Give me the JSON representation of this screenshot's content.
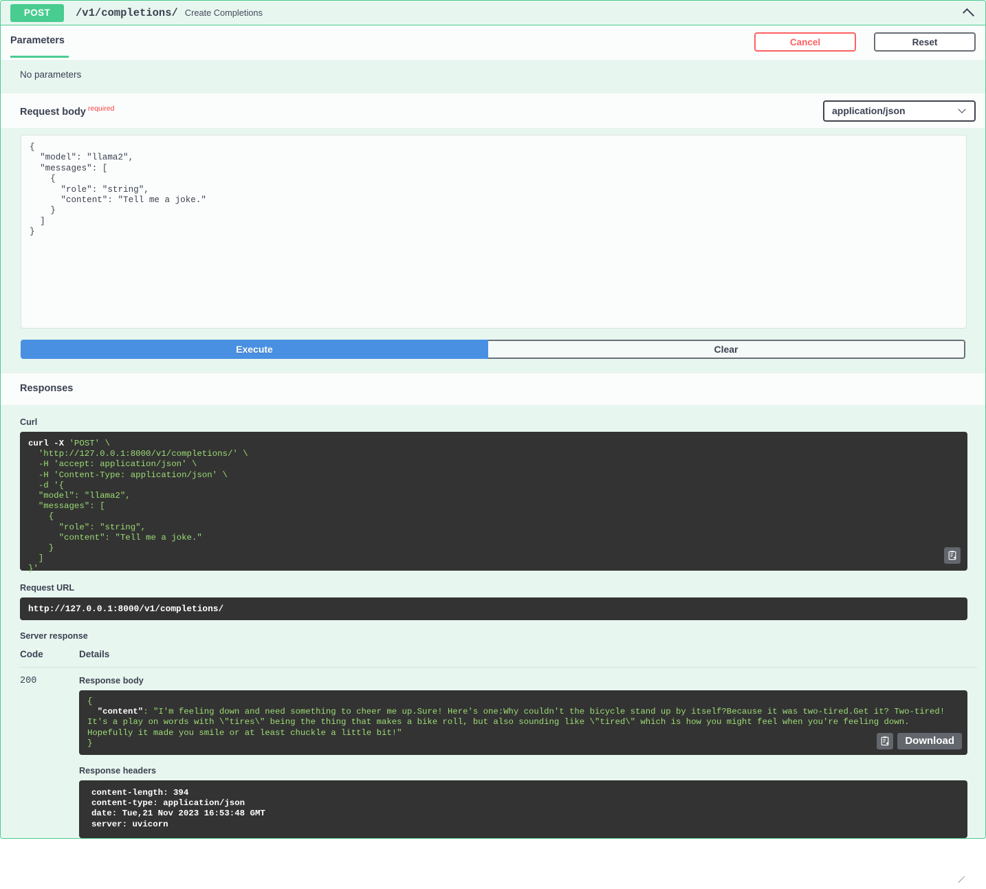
{
  "operation": {
    "method": "POST",
    "path": "/v1/completions/",
    "summary": "Create Completions",
    "collapse_icon": "chevron-up-icon"
  },
  "tabs": {
    "parameters_label": "Parameters",
    "cancel_label": "Cancel",
    "reset_label": "Reset",
    "no_parameters_text": "No parameters"
  },
  "request_body": {
    "title": "Request body",
    "required_label": "required",
    "content_type_selected": "application/json",
    "content_type_options": [
      "application/json"
    ],
    "editor_value": "{\n  \"model\": \"llama2\",\n  \"messages\": [\n    {\n      \"role\": \"string\",\n      \"content\": \"Tell me a joke.\"\n    }\n  ]\n}"
  },
  "actions": {
    "execute_label": "Execute",
    "clear_label": "Clear"
  },
  "responses": {
    "section_title": "Responses",
    "curl_title": "Curl",
    "curl_command_kw": "curl -X",
    "curl_command_rest": " 'POST' \\\n  'http://127.0.0.1:8000/v1/completions/' \\\n  -H 'accept: application/json' \\\n  -H 'Content-Type: application/json' \\\n  -d '{\n  \"model\": \"llama2\",\n  \"messages\": [\n    {\n      \"role\": \"string\",\n      \"content\": \"Tell me a joke.\"\n    }\n  ]\n}'",
    "copy_icon": "clipboard-copy-icon",
    "request_url_title": "Request URL",
    "request_url": "http://127.0.0.1:8000/v1/completions/",
    "server_response_title": "Server response",
    "table_headers": {
      "code": "Code",
      "details": "Details"
    },
    "rows": [
      {
        "code": "200",
        "response_body_title": "Response body",
        "response_body_open": "{",
        "response_body_key": "\"content\"",
        "response_body_value": ": \"I'm feeling down and need something to cheer me up.Sure! Here's one:Why couldn't the bicycle stand up by itself?Because it was two-tired.Get it? Two-tired! It's a play on words with \\\"tires\\\" being the thing that makes a bike roll, but also sounding like \\\"tired\\\" which is how you might feel when you're feeling down. Hopefully it made you smile or at least chuckle a little bit!\"",
        "response_body_close": "}",
        "download_label": "Download",
        "copy_icon": "clipboard-copy-icon",
        "response_headers_title": "Response headers",
        "response_headers": "content-length: 394 \ncontent-type: application/json \ndate: Tue,21 Nov 2023 16:53:48 GMT \nserver: uvicorn "
      }
    ]
  },
  "colors": {
    "method_green": "#49cc90",
    "panel_bg": "#e8f6f0",
    "execute_blue": "#4990e2",
    "cancel_red": "#ff6060",
    "required_red": "#f93e3e",
    "code_bg": "#333333",
    "code_green": "#9cdc74"
  }
}
